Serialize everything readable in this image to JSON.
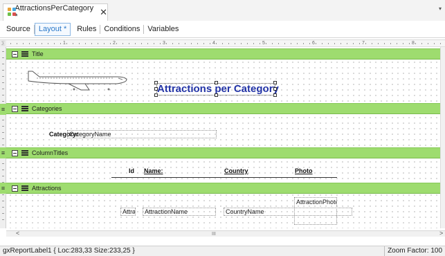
{
  "document_tab": {
    "title": "AttractionsPerCategory *",
    "close_glyph": "✕",
    "overflow_glyph": "▾"
  },
  "subtabs": [
    {
      "label": "Source",
      "active": false
    },
    {
      "label": "Layout *",
      "active": true
    },
    {
      "label": "Rules",
      "active": false
    },
    {
      "label": "Conditions",
      "active": false
    },
    {
      "label": "Variables",
      "active": false
    }
  ],
  "ruler": {
    "numbers": [
      "1",
      "2",
      "3",
      "4",
      "5",
      "6",
      "7",
      "8"
    ]
  },
  "bands": {
    "title": {
      "label": "Title",
      "report_title": "Attractions per Category",
      "airplane_icon": "airplane-image"
    },
    "categories": {
      "label": "Categories",
      "category_label": "Category:",
      "category_field": "CategoryName"
    },
    "column_titles": {
      "label": "ColumnTitles",
      "columns": [
        "Id",
        "Name:",
        "Country",
        "Photo"
      ]
    },
    "attractions": {
      "label": "Attractions",
      "id_field": "Attra",
      "name_field": "AttractionName",
      "country_field": "CountryName",
      "photo_field": "AttractionPhoto"
    }
  },
  "left_markers": [
    "≡",
    "≡",
    "≡"
  ],
  "scroll": {
    "left_arrow": "<",
    "right_arrow": ">",
    "grip": "III"
  },
  "status": {
    "left": "gxReportLabel1 { Loc:283,33 Size:233,25 }",
    "right": "Zoom Factor: 100"
  },
  "colors": {
    "band_green": "#9edc6f",
    "title_blue": "#2233a6",
    "active_tab": "#2a78c8"
  }
}
